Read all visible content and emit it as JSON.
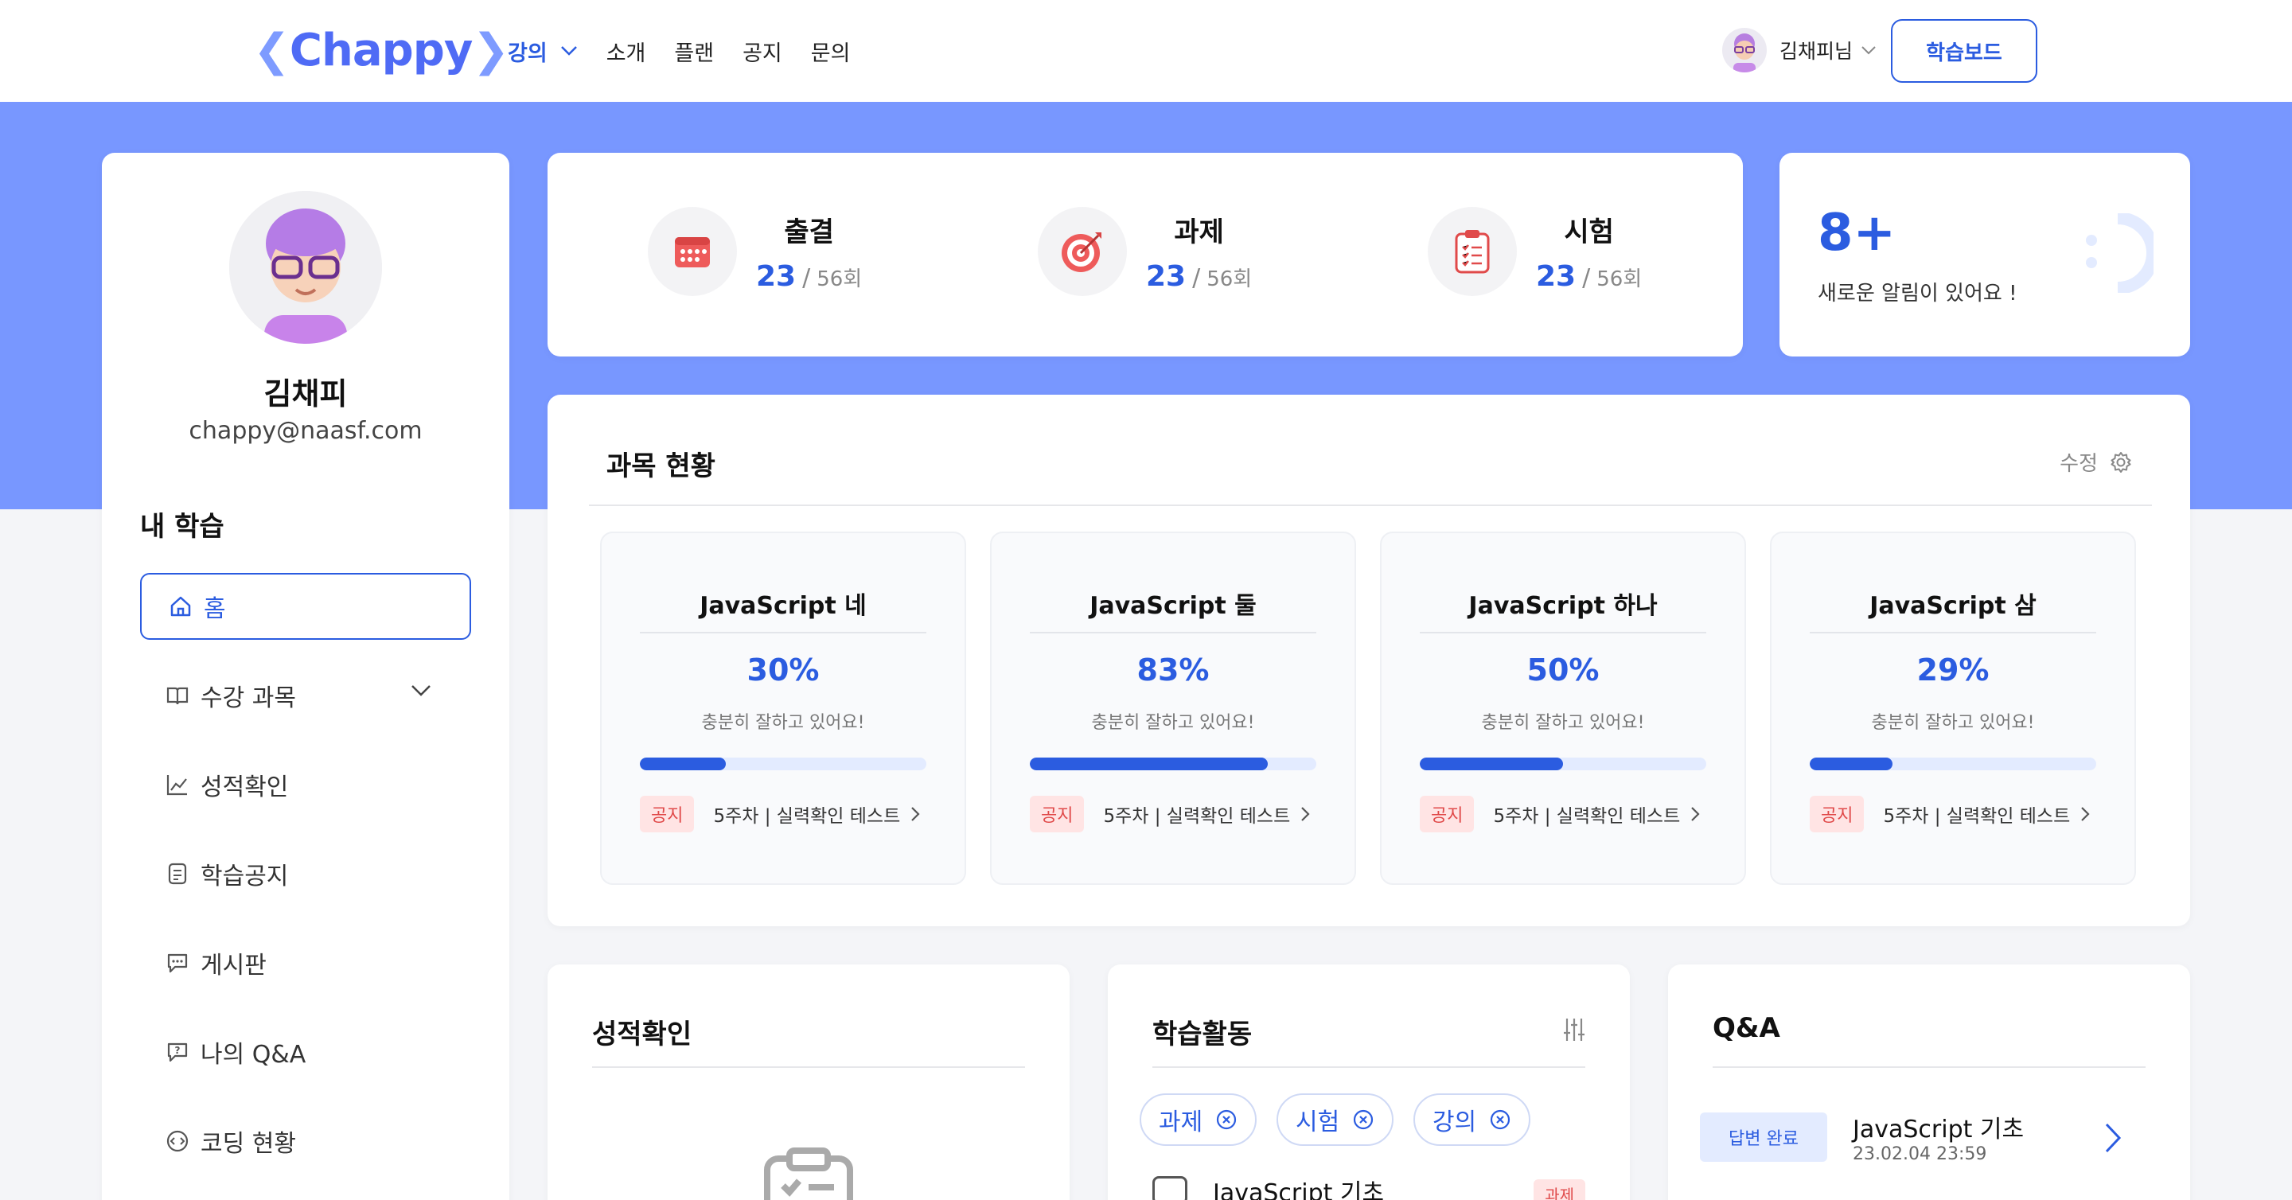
{
  "header": {
    "logo_left": "❮",
    "logo_text": "Chappy",
    "logo_right": "❯",
    "nav": [
      {
        "label": "강의"
      },
      {
        "label": "소개"
      },
      {
        "label": "플랜"
      },
      {
        "label": "공지"
      },
      {
        "label": "문의"
      }
    ],
    "user_name": "김채피님",
    "dashboard_button": "학습보드"
  },
  "profile": {
    "name": "김채피",
    "email": "chappy@naasf.com"
  },
  "sidebar": {
    "title": "내 학습",
    "items": [
      {
        "label": "홈",
        "icon": "home-icon"
      },
      {
        "label": "수강 과목",
        "icon": "book-icon"
      },
      {
        "label": "성적확인",
        "icon": "chart-icon"
      },
      {
        "label": "학습공지",
        "icon": "notice-icon"
      },
      {
        "label": "게시판",
        "icon": "chat-icon"
      },
      {
        "label": "나의 Q&A",
        "icon": "question-icon"
      },
      {
        "label": "코딩 현황",
        "icon": "code-icon"
      }
    ]
  },
  "stats": [
    {
      "title": "출결",
      "value": "23",
      "sep": "/",
      "total": "56회",
      "icon": "calendar-icon"
    },
    {
      "title": "과제",
      "value": "23",
      "sep": "/",
      "total": "56회",
      "icon": "target-icon"
    },
    {
      "title": "시험",
      "value": "23",
      "sep": "/",
      "total": "56회",
      "icon": "clipboard-icon"
    }
  ],
  "notification": {
    "count": "8+",
    "text": "새로운 알림이 있어요 !"
  },
  "course_status": {
    "title": "과목 현황",
    "edit_label": "수정",
    "courses": [
      {
        "name": "JavaScript 네",
        "percent": "30%",
        "progress": 0.3,
        "message": "충분히 잘하고 있어요!",
        "tag": "공지",
        "notice": "5주차 | 실력확인 테스트"
      },
      {
        "name": "JavaScript 둘",
        "percent": "83%",
        "progress": 0.83,
        "message": "충분히 잘하고 있어요!",
        "tag": "공지",
        "notice": "5주차 | 실력확인 테스트"
      },
      {
        "name": "JavaScript 하나",
        "percent": "50%",
        "progress": 0.5,
        "message": "충분히 잘하고 있어요!",
        "tag": "공지",
        "notice": "5주차 | 실력확인 테스트"
      },
      {
        "name": "JavaScript 삼",
        "percent": "29%",
        "progress": 0.29,
        "message": "충분히 잘하고 있어요!",
        "tag": "공지",
        "notice": "5주차 | 실력확인 테스트"
      }
    ]
  },
  "grades": {
    "title": "성적확인"
  },
  "activity": {
    "title": "학습활동",
    "chips": [
      "과제",
      "시험",
      "강의"
    ],
    "item_title": "JavaScript 기초",
    "item_tag": "과제"
  },
  "qa": {
    "title": "Q&A",
    "badge": "답변 완료",
    "item_title": "JavaScript 기초",
    "item_date": "23.02.04 23:59"
  },
  "colors": {
    "accent": "#2b5ce0",
    "band": "#7897ff",
    "tag_bg": "#ffe4e4",
    "tag_fg": "#e04a4a"
  }
}
